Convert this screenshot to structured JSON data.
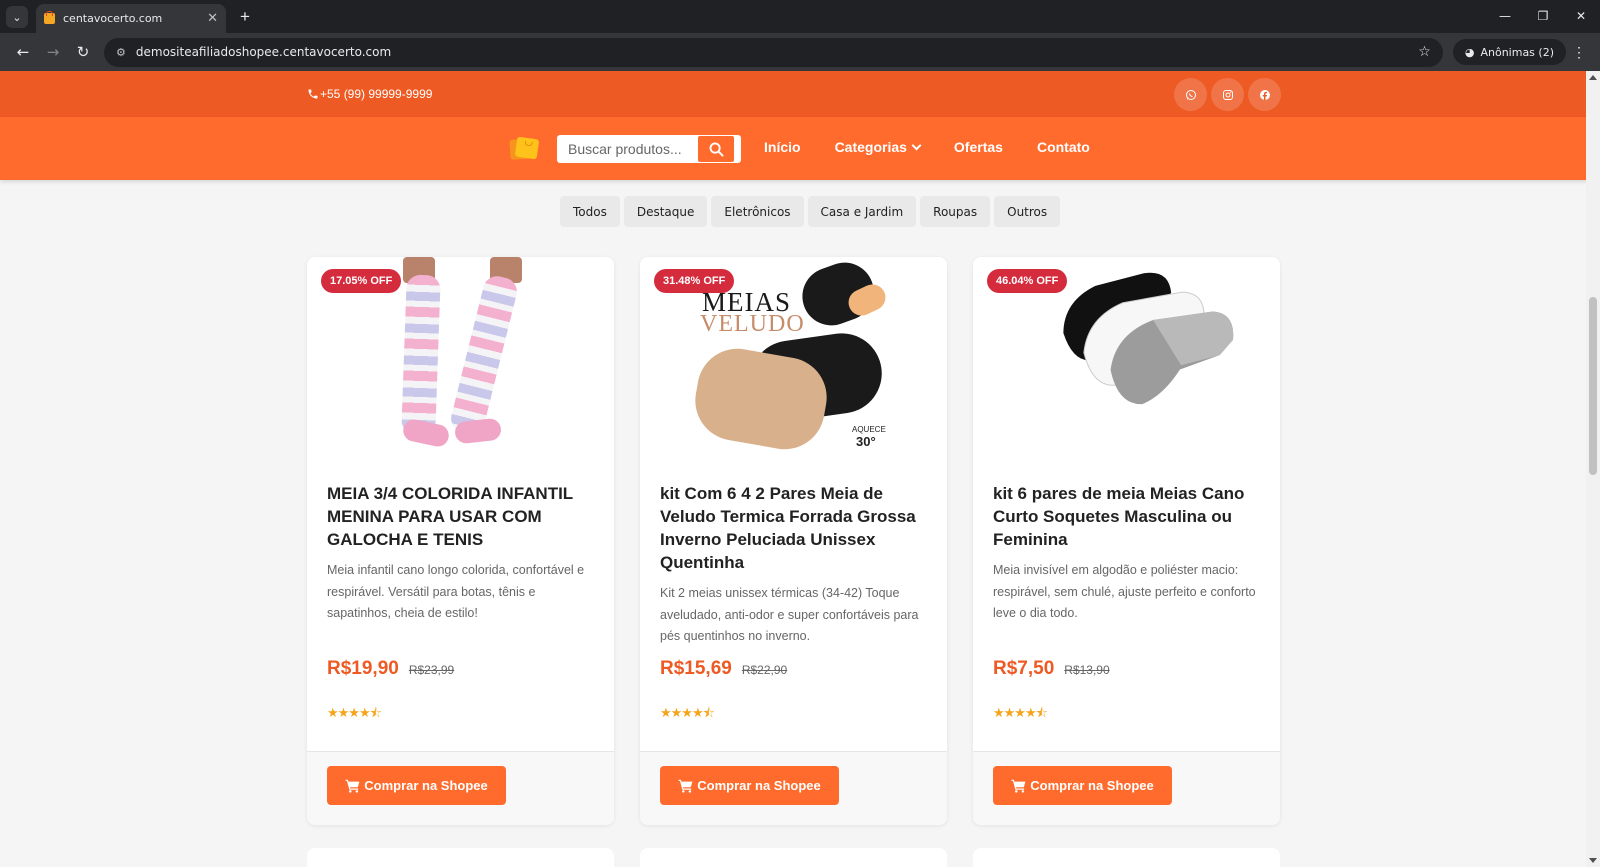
{
  "browser": {
    "tab_title": "centavocerto.com",
    "url": "demositeafiliadoshopee.centavocerto.com",
    "incognito_label": "Anônimas (2)"
  },
  "topbar": {
    "phone": "+55 (99) 99999-9999",
    "socials": [
      "whatsapp-icon",
      "instagram-icon",
      "facebook-icon"
    ]
  },
  "nav": {
    "search_placeholder": "Buscar produtos...",
    "menu": [
      "Início",
      "Categorias",
      "Ofertas",
      "Contato"
    ]
  },
  "filters": [
    "Todos",
    "Destaque",
    "Eletrônicos",
    "Casa e Jardim",
    "Roupas",
    "Outros"
  ],
  "products": [
    {
      "badge": "17.05% OFF",
      "title": "MEIA 3/4 COLORIDA INFANTIL MENINA PARA USAR COM GALOCHA E TENIS",
      "description": "Meia infantil cano longo colorida, confortável e respirável. Versátil para botas, tênis e sapatinhos, cheia de estilo!",
      "price": "R$19,90",
      "old_price": "R$23,99",
      "rating_stars": 4.5,
      "buy_label": "Comprar na Shopee"
    },
    {
      "badge": "31.48% OFF",
      "title": "kit Com 6 4 2 Pares Meia de Veludo Termica Forrada Grossa Inverno Peluciada Unissex Quentinha",
      "description": "Kit 2 meias unissex térmicas (34-42) Toque aveludado, anti-odor e super confortáveis para pés quentinhos no inverno.",
      "price": "R$15,69",
      "old_price": "R$22,90",
      "rating_stars": 4.5,
      "buy_label": "Comprar na Shopee",
      "image_text": {
        "line1": "MEIAS",
        "line2": "VELUDO",
        "heat_label": "AQUECE",
        "heat_value": "30°"
      }
    },
    {
      "badge": "46.04% OFF",
      "title": "kit 6 pares de meia Meias Cano Curto Soquetes Masculina ou Feminina",
      "description": "Meia invisível em algodão e poliéster macio: respirável, sem chulé, ajuste perfeito e conforto leve o dia todo.",
      "price": "R$7,50",
      "old_price": "R$13,90",
      "rating_stars": 4.5,
      "buy_label": "Comprar na Shopee"
    }
  ],
  "colors": {
    "topbar": "#ee5a24",
    "navbar": "#ff6b2c",
    "badge": "#d42b3d",
    "price": "#ee5a24",
    "stars": "#f4a51c"
  }
}
